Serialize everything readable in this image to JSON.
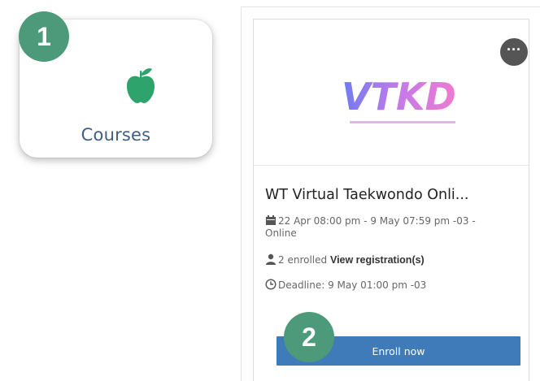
{
  "badges": {
    "step1": "1",
    "step2": "2"
  },
  "courses_tile": {
    "label": "Courses",
    "icon": "apple-icon",
    "icon_color": "#2ea36c"
  },
  "card": {
    "more_icon": "more-options-icon",
    "logo_text": "VTKD",
    "title": "WT Virtual Taekwondo Onli...",
    "dates": "22 Apr 08:00 pm - 9 May 07:59 pm -03 - Online",
    "enrolled_count": "2 enrolled",
    "view_registration": "View registration(s)",
    "deadline": "Deadline: 9 May 01:00 pm -03",
    "enroll_button": "Enroll now"
  },
  "colors": {
    "badge": "#4c9a7a",
    "button": "#3f7ab9",
    "label": "#3d5f86"
  }
}
